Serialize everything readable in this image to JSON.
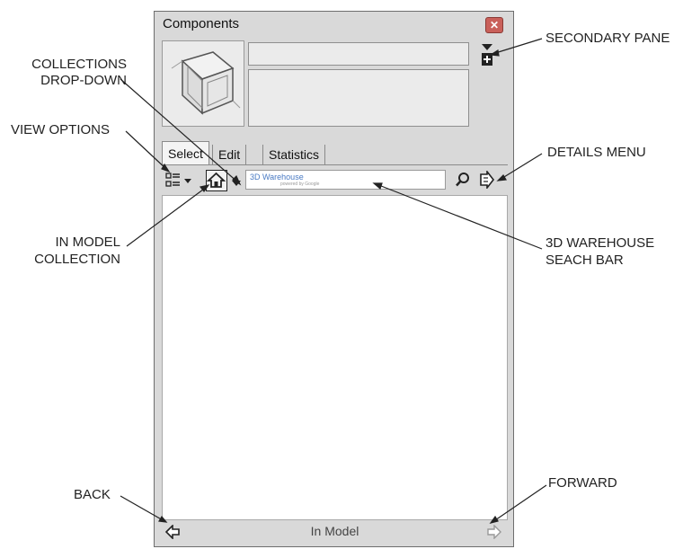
{
  "window": {
    "title": "Components",
    "close_glyph": "✕"
  },
  "tabs": [
    {
      "label": "Select",
      "active": true
    },
    {
      "label": "Edit",
      "active": false
    },
    {
      "label": "Statistics",
      "active": false
    }
  ],
  "search": {
    "brand": "3D Warehouse",
    "sub": "powered by Google"
  },
  "status": {
    "label": "In Model"
  },
  "callouts": {
    "secondary_pane": "SECONDARY PANE",
    "collections_line1": "COLLECTIONS",
    "collections_line2": "DROP-DOWN",
    "view_options": "VIEW OPTIONS",
    "details_menu": "DETAILS MENU",
    "in_model_line1": "IN MODEL",
    "in_model_line2": "COLLECTION",
    "warehouse_line1": "3D WAREHOUSE",
    "warehouse_line2": "SEACH BAR",
    "back": "BACK",
    "forward": "FORWARD"
  },
  "icons": {
    "close": "close-icon",
    "view_options": "list-view-icon",
    "home": "home-icon",
    "search": "magnifier-icon",
    "details": "details-arrow-icon",
    "back": "back-arrow-icon",
    "forward": "forward-arrow-icon",
    "secondary": "secondary-pane-icon"
  },
  "colors": {
    "window_bg": "#d9d9d9",
    "close_bg": "#c9605a",
    "search_brand": "#4a7bc4"
  }
}
